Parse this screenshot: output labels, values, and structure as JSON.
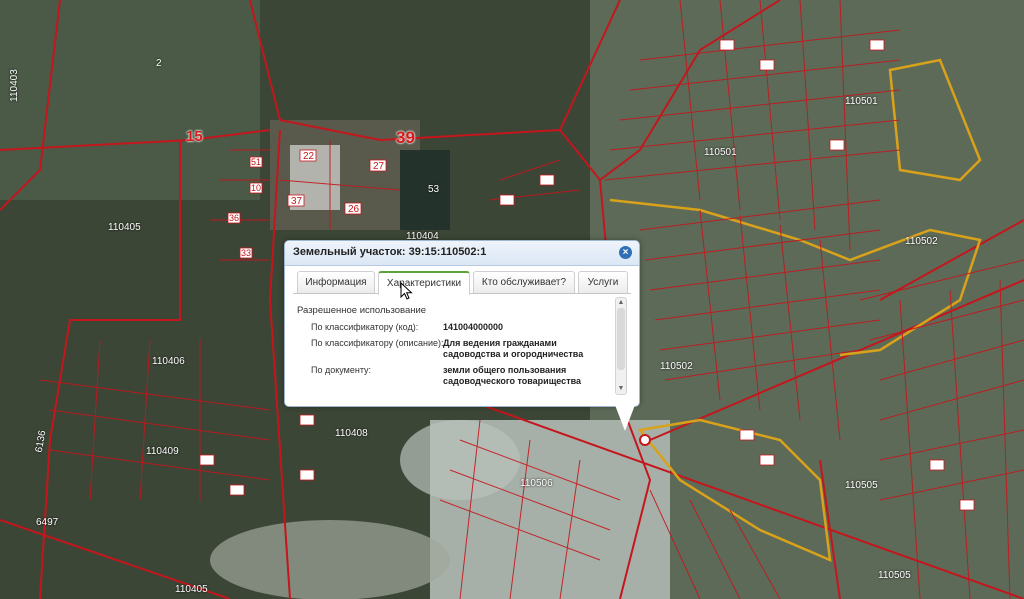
{
  "popup": {
    "title": "Земельный участок: 39:15:110502:1",
    "close_icon": "close-icon",
    "tabs": [
      {
        "label": "Информация",
        "active": false
      },
      {
        "label": "Характеристики",
        "active": true
      },
      {
        "label": "Кто обслуживает?",
        "active": false
      },
      {
        "label": "Услуги",
        "active": false
      }
    ],
    "content": {
      "section": "Разрешенное использование",
      "rows": [
        {
          "label": "По классификатору (код):",
          "value": "141004000000"
        },
        {
          "label": "По классификатору (описание):",
          "value": "Для ведения гражданами садоводства и огородничества"
        },
        {
          "label": "По документу:",
          "value": "земли общего пользования садоводческого товарищества"
        }
      ]
    }
  },
  "map": {
    "quarter_labels": [
      "110501",
      "110501",
      "110502",
      "110502",
      "110506",
      "110505",
      "110505",
      "110405",
      "110405",
      "110406",
      "110408",
      "110409",
      "110404"
    ],
    "big_labels": [
      "39",
      "15"
    ],
    "parcel_labels": [
      "2",
      "22",
      "27",
      "37",
      "26",
      "53",
      "51",
      "10",
      "36",
      "33",
      "6497",
      "6136"
    ],
    "side_label": "110403",
    "colors": {
      "parcel": "#c4161c",
      "highlight": "#d9a21b"
    }
  }
}
